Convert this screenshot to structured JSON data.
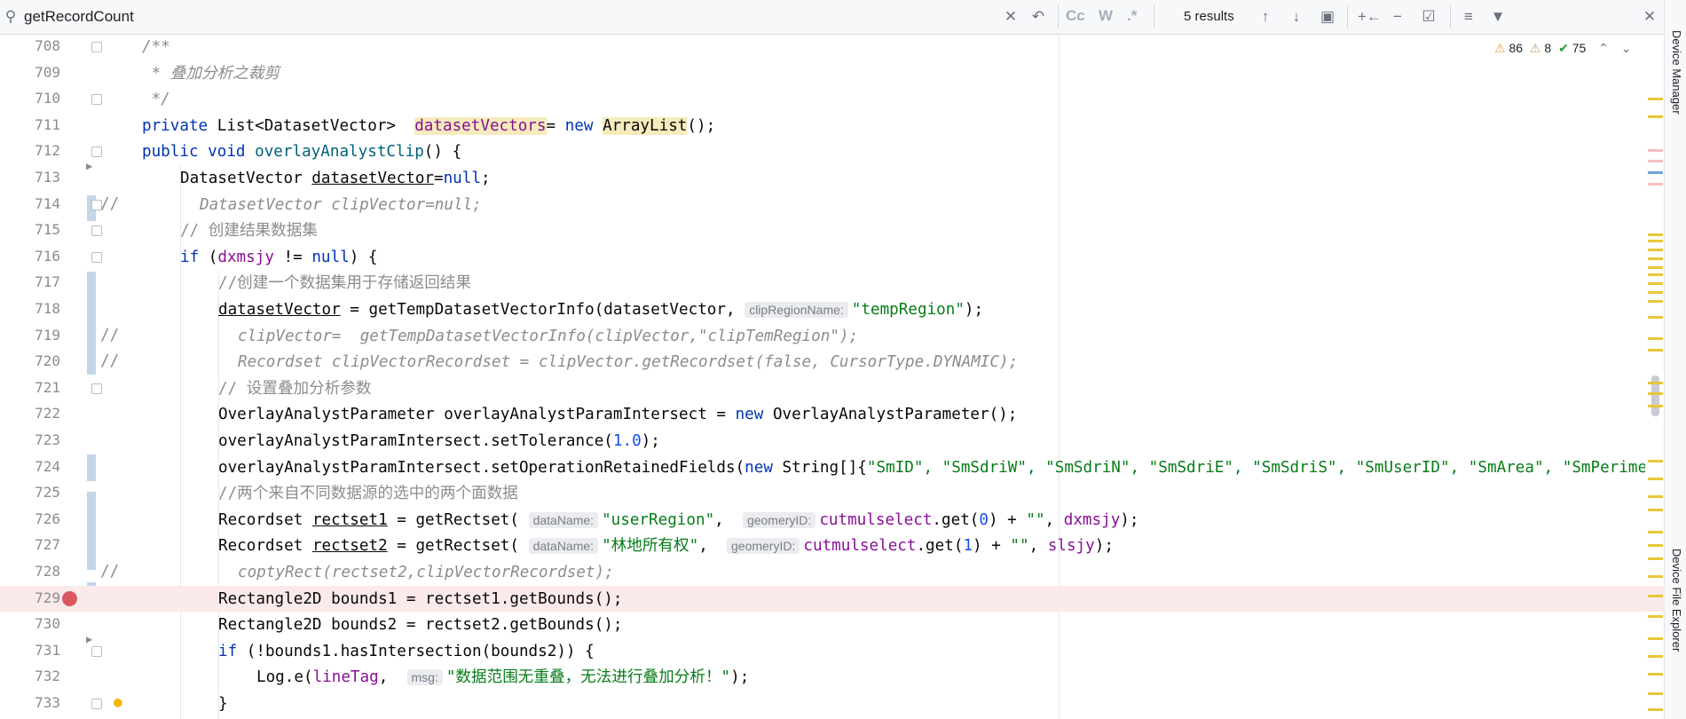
{
  "search": {
    "query": "getRecordCount",
    "results": "5 results"
  },
  "inspections": {
    "warnings": "86",
    "weak_warnings": "8",
    "ok": "75"
  },
  "tool_windows": {
    "device_manager": "Device Manager",
    "device_file_explorer": "Device File Explorer"
  },
  "hints": {
    "clipRegionName": "clipRegionName:",
    "dataName": "dataName:",
    "geomeryID": "geomeryID:",
    "msg": "msg:"
  },
  "colors": {
    "keyword": "#0033b3",
    "string": "#067d17",
    "comment": "#8c8c8c",
    "field": "#871094",
    "method": "#00627a",
    "breakpoint": "#db5860"
  },
  "lines": [
    {
      "n": "708",
      "t": "/**"
    },
    {
      "n": "709",
      "t": " * 叠加分析之裁剪"
    },
    {
      "n": "710",
      "t": " */"
    },
    {
      "n": "711",
      "kw1": "private",
      "a": " List<DatasetVector>  ",
      "hl": "datasetVectors",
      "b": "= ",
      "kw2": "new",
      "c": " ",
      "hl2": "ArrayList",
      "d": "();"
    },
    {
      "n": "712",
      "kw1": "public void",
      "fn": "overlayAnalystClip",
      "d": "() {"
    },
    {
      "n": "713",
      "a": "DatasetVector ",
      "u": "datasetVector",
      "b": "=",
      "kw2": "null",
      "d": ";"
    },
    {
      "n": "714",
      "cm": "//",
      "t": "DatasetVector clipVector=null;"
    },
    {
      "n": "715",
      "t": "// 创建结果数据集"
    },
    {
      "n": "716",
      "kw1": "if",
      "a": " (",
      "fld": "dxmsjy",
      "b": " != ",
      "kw2": "null",
      "d": ") {"
    },
    {
      "n": "717",
      "t": "//创建一个数据集用于存储返回结果"
    },
    {
      "n": "718",
      "u": "datasetVector",
      "a": " = getTempDatasetVectorInfo(datasetVector, ",
      "s": "\"tempRegion\"",
      "d": ");"
    },
    {
      "n": "719",
      "cm": "//",
      "t": "clipVector=  getTempDatasetVectorInfo(clipVector,\"clipTemRegion\");"
    },
    {
      "n": "720",
      "cm": "//",
      "t": "Recordset clipVectorRecordset = clipVector.getRecordset(false, CursorType.DYNAMIC);"
    },
    {
      "n": "721",
      "t": "// 设置叠加分析参数"
    },
    {
      "n": "722",
      "a": "OverlayAnalystParameter overlayAnalystParamIntersect = ",
      "kw2": "new",
      "d": " OverlayAnalystParameter();"
    },
    {
      "n": "723",
      "a": "overlayAnalystParamIntersect.setTolerance(",
      "num": "1.0",
      "d": ");"
    },
    {
      "n": "724",
      "a": "overlayAnalystParamIntersect.setOperationRetainedFields(",
      "kw2": "new",
      "b": " String[]{",
      "s": "\"SmID\", \"SmSdriW\", \"SmSdriN\", \"SmSdriE\", \"SmSdriS\", \"SmUserID\", \"SmArea\", \"SmPerimeter\""
    },
    {
      "n": "725",
      "t": "//两个来自不同数据源的选中的两个面数据"
    },
    {
      "n": "726",
      "a": "Recordset ",
      "u": "rectset1",
      "b": " = getRectset( ",
      "s1": "\"userRegion\"",
      "c": ",  ",
      "fld": "cutmulselect",
      "e": ".get(",
      "num": "0",
      "f": ") + ",
      "s2": "\"\"",
      "g": ", ",
      "fld2": "dxmsjy",
      "d": ");"
    },
    {
      "n": "727",
      "a": "Recordset ",
      "u": "rectset2",
      "b": " = getRectset( ",
      "s1": "\"林地所有权\"",
      "c": ",  ",
      "fld": "cutmulselect",
      "e": ".get(",
      "num": "1",
      "f": ") + ",
      "s2": "\"\"",
      "g": ", ",
      "fld2": "slsjy",
      "d": ");"
    },
    {
      "n": "728",
      "cm": "//",
      "t": "coptyRect(rectset2,clipVectorRecordset);"
    },
    {
      "n": "729",
      "t": "Rectangle2D bounds1 = rectset1.getBounds();"
    },
    {
      "n": "730",
      "t": "Rectangle2D bounds2 = rectset2.getBounds();"
    },
    {
      "n": "731",
      "kw1": "if",
      "d": " (!bounds1.hasIntersection(bounds2)) {"
    },
    {
      "n": "732",
      "a": "Log.e(",
      "fld": "lineTag",
      "b": ",  ",
      "s": "\"数据范围无重叠，无法进行叠加分析！\"",
      "d": ");"
    },
    {
      "n": "733",
      "t": "}"
    }
  ]
}
